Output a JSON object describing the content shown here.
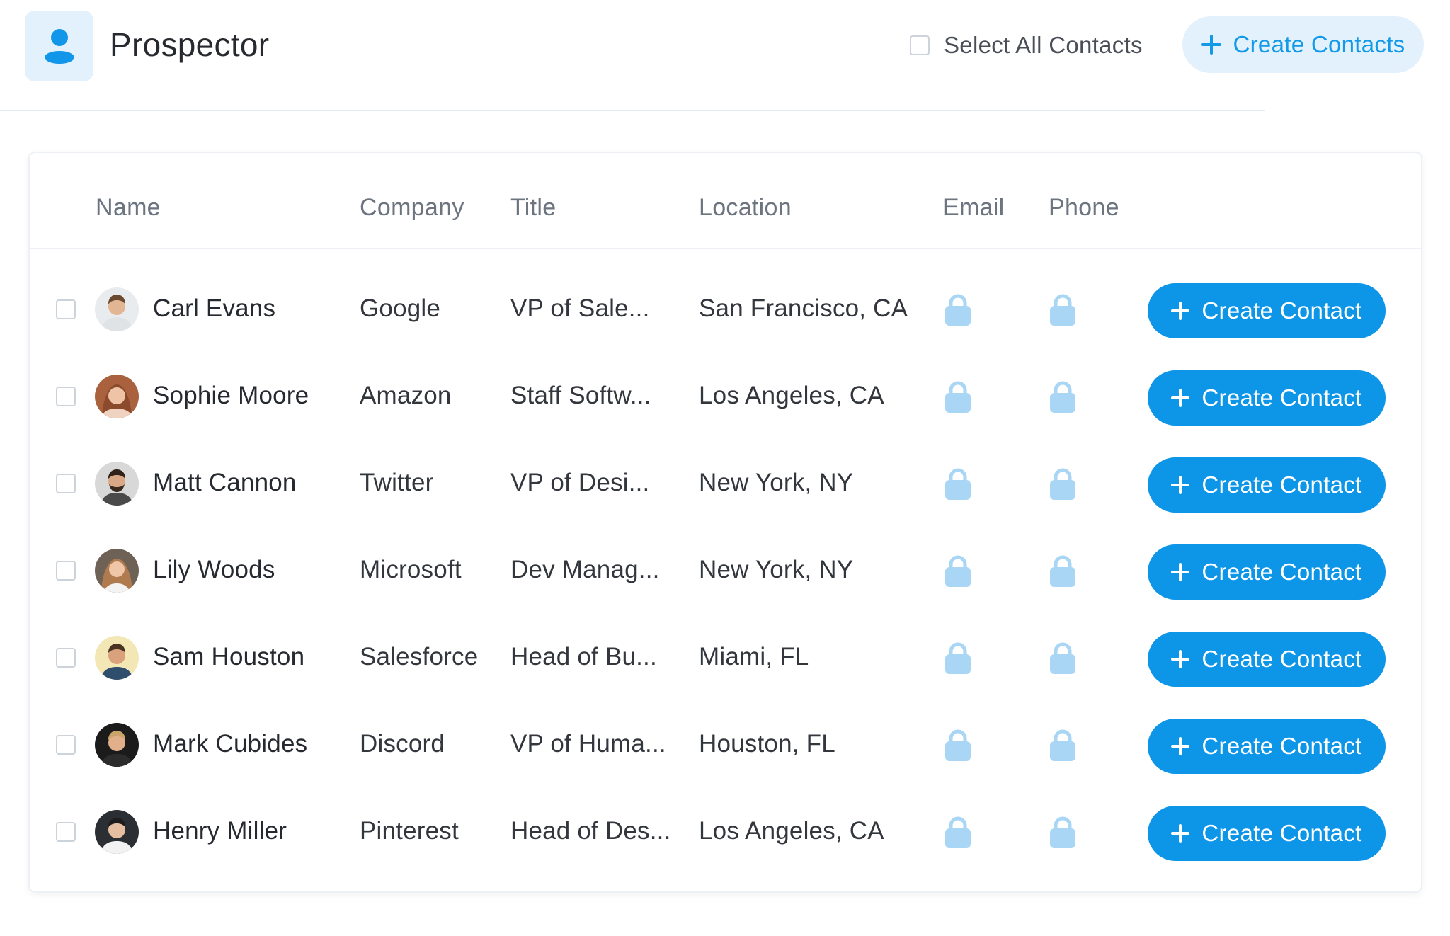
{
  "app": {
    "title": "Prospector",
    "logo_icon": "user-icon",
    "accent_color": "#0d95e8",
    "accent_light": "#e3f1fd"
  },
  "toolbar": {
    "select_all_label": "Select All Contacts",
    "select_all_checked": false,
    "create_contacts_label": "Create Contacts",
    "create_contacts_icon": "plus-icon"
  },
  "table": {
    "columns": {
      "name": "Name",
      "company": "Company",
      "title": "Title",
      "location": "Location",
      "email": "Email",
      "phone": "Phone"
    },
    "rows": [
      {
        "name": "Carl Evans",
        "company": "Google",
        "title": "VP of Sale...",
        "location": "San Francisco, CA",
        "email_icon": "lock-icon",
        "phone_icon": "lock-icon",
        "action": "Create Contact",
        "checked": false
      },
      {
        "name": "Sophie Moore",
        "company": "Amazon",
        "title": "Staff Softw...",
        "location": "Los Angeles, CA",
        "email_icon": "lock-icon",
        "phone_icon": "lock-icon",
        "action": "Create Contact",
        "checked": false
      },
      {
        "name": "Matt Cannon",
        "company": "Twitter",
        "title": "VP of Desi...",
        "location": "New York, NY",
        "email_icon": "lock-icon",
        "phone_icon": "lock-icon",
        "action": "Create Contact",
        "checked": false
      },
      {
        "name": "Lily Woods",
        "company": "Microsoft",
        "title": "Dev Manag...",
        "location": "New York, NY",
        "email_icon": "lock-icon",
        "phone_icon": "lock-icon",
        "action": "Create Contact",
        "checked": false
      },
      {
        "name": "Sam Houston",
        "company": "Salesforce",
        "title": "Head of Bu...",
        "location": "Miami, FL",
        "email_icon": "lock-icon",
        "phone_icon": "lock-icon",
        "action": "Create Contact",
        "checked": false
      },
      {
        "name": "Mark Cubides",
        "company": "Discord",
        "title": "VP of Huma...",
        "location": "Houston, FL",
        "email_icon": "lock-icon",
        "phone_icon": "lock-icon",
        "action": "Create Contact",
        "checked": false
      },
      {
        "name": "Henry Miller",
        "company": "Pinterest",
        "title": "Head of Des...",
        "location": "Los Angeles, CA",
        "email_icon": "lock-icon",
        "phone_icon": "lock-icon",
        "action": "Create Contact",
        "checked": false
      }
    ]
  }
}
